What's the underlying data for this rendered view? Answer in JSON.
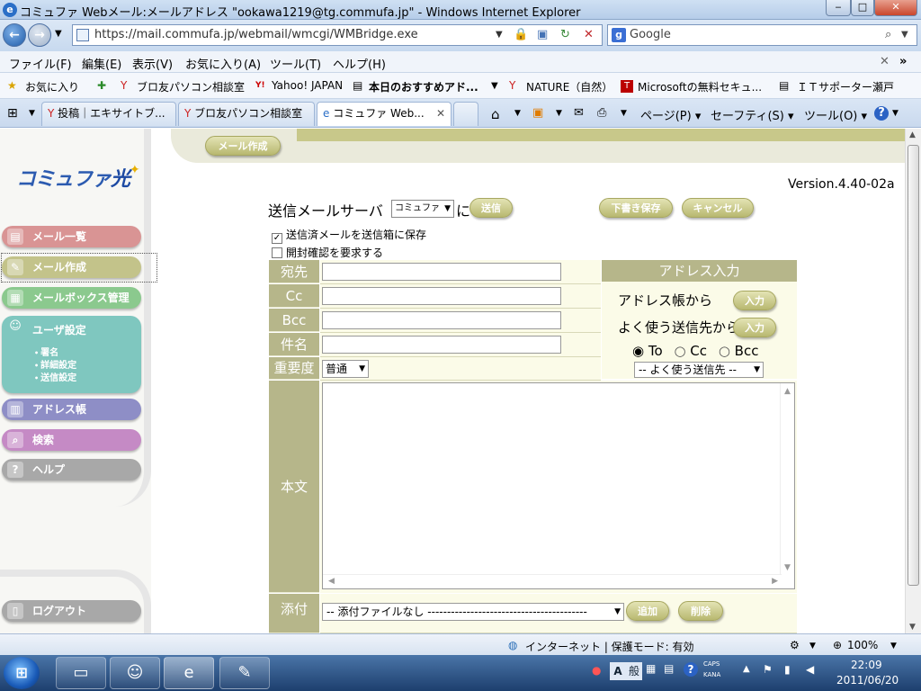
{
  "window": {
    "title": "コミュファ Webメール:メールアドレス \"ookawa1219@tg.commufa.jp\" - Windows Internet Explorer",
    "minimize": "‒",
    "maximize": "□",
    "close": "✕"
  },
  "address_bar": {
    "url": "https://mail.commufa.jp/webmail/wmcgi/WMBridge.exe",
    "search_text": "Google"
  },
  "menu": [
    "ファイル(F)",
    "編集(E)",
    "表示(V)",
    "お気に入り(A)",
    "ツール(T)",
    "ヘルプ(H)"
  ],
  "favorites": {
    "label": "お気に入り",
    "items": [
      "ブロ友パソコン相談室",
      "Yahoo! JAPAN",
      "本日のおすすめアド...",
      "NATURE（自然）",
      "Microsoftの無料セキュ...",
      "ＩＴサポーター瀬戸"
    ]
  },
  "tabs": [
    {
      "label": "投稿｜エキサイトブ..."
    },
    {
      "label": "ブロ友パソコン相談室"
    },
    {
      "label": "コミュファ Web..."
    }
  ],
  "toolbar": {
    "page": "ページ(P)",
    "safety": "セーフティ(S)",
    "tools": "ツール(O)"
  },
  "sidebar": {
    "logo_text": "コミュファ",
    "logo_hikari": "光",
    "items": [
      {
        "label": "メール一覧",
        "color": "#d99494"
      },
      {
        "label": "メール作成",
        "color": "#c3c38a"
      },
      {
        "label": "メールボックス管理",
        "color": "#8bc98e"
      },
      {
        "label": "アドレス帳",
        "color": "#8e8ec6"
      },
      {
        "label": "検索",
        "color": "#c58ac5"
      },
      {
        "label": "ヘルプ",
        "color": "#a8a8a8"
      },
      {
        "label": "ログアウト",
        "color": "#a8a8a8"
      }
    ],
    "user_settings": {
      "label": "ユーザ設定",
      "color": "#7fc7bf",
      "subs": [
        "署名",
        "詳細設定",
        "送信設定"
      ]
    }
  },
  "compose": {
    "header_button": "メール作成",
    "version": "Version.4.40-02a",
    "server_label": "送信メールサーバ",
    "server_value": "コミュファ",
    "server_suffix": "に",
    "send": "送信",
    "draft": "下書き保存",
    "cancel": "キャンセル",
    "save_sent": "送信済メールを送信箱に保存",
    "save_sent_checked": true,
    "read_receipt": "開封確認を要求する",
    "read_receipt_checked": false,
    "labels": {
      "to": "宛先",
      "cc": "Cc",
      "bcc": "Bcc",
      "subject": "件名",
      "priority": "重要度",
      "body": "本文",
      "attach": "添付"
    },
    "priority_value": "普通",
    "address_panel": {
      "title": "アドレス入力",
      "from_book": "アドレス帳から",
      "from_frequent": "よく使う送信先から",
      "input_btn": "入力",
      "radio_to": "To",
      "radio_cc": "Cc",
      "radio_bcc": "Bcc",
      "radio_selected": "To",
      "frequent_select": "-- よく使う送信先 --"
    },
    "attach_select": "-- 添付ファイルなし -----------------------------------------",
    "add": "追加",
    "delete": "削除"
  },
  "statusbar": {
    "zone": "インターネット | 保護モード: 有効",
    "zoom": "100%"
  },
  "taskbar": {
    "ime_a": "A",
    "ime_mode": "般",
    "caps": "CAPS",
    "kana": "KANA",
    "time": "22:09",
    "date": "2011/06/20"
  },
  "colors": {
    "olive": "#b6b68a",
    "form_bg": "#fbfbe8"
  }
}
